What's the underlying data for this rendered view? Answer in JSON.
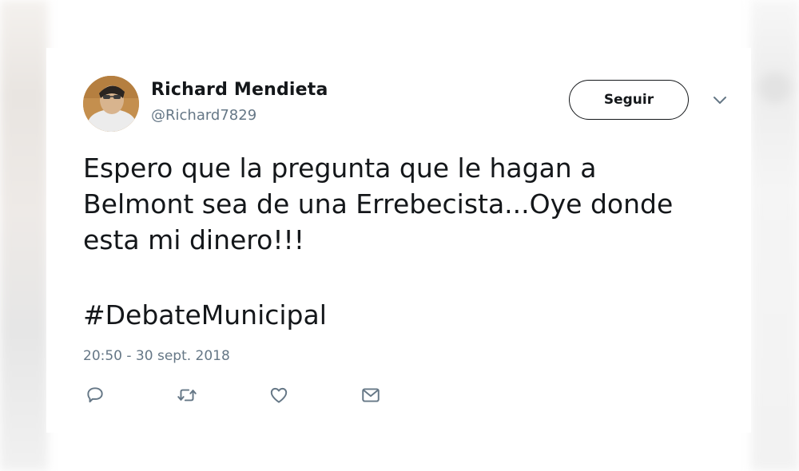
{
  "author": {
    "name": "Richard Mendieta",
    "handle": "@Richard7829",
    "avatar_icon": "user-avatar-photo"
  },
  "follow_button": {
    "label": "Seguir"
  },
  "tweet": {
    "lines": [
      "Espero que la pregunta que le hagan a",
      "Belmont sea de una Errebecista...Oye donde",
      "esta mi dinero!!!"
    ],
    "hashtag": "#DebateMunicipal",
    "timestamp": "20:50 - 30 sept. 2018"
  },
  "actions": [
    {
      "icon": "reply-icon"
    },
    {
      "icon": "retweet-icon"
    },
    {
      "icon": "like-icon"
    },
    {
      "icon": "direct-message-icon"
    }
  ],
  "colors": {
    "text": "#14171a",
    "secondary": "#657786"
  }
}
